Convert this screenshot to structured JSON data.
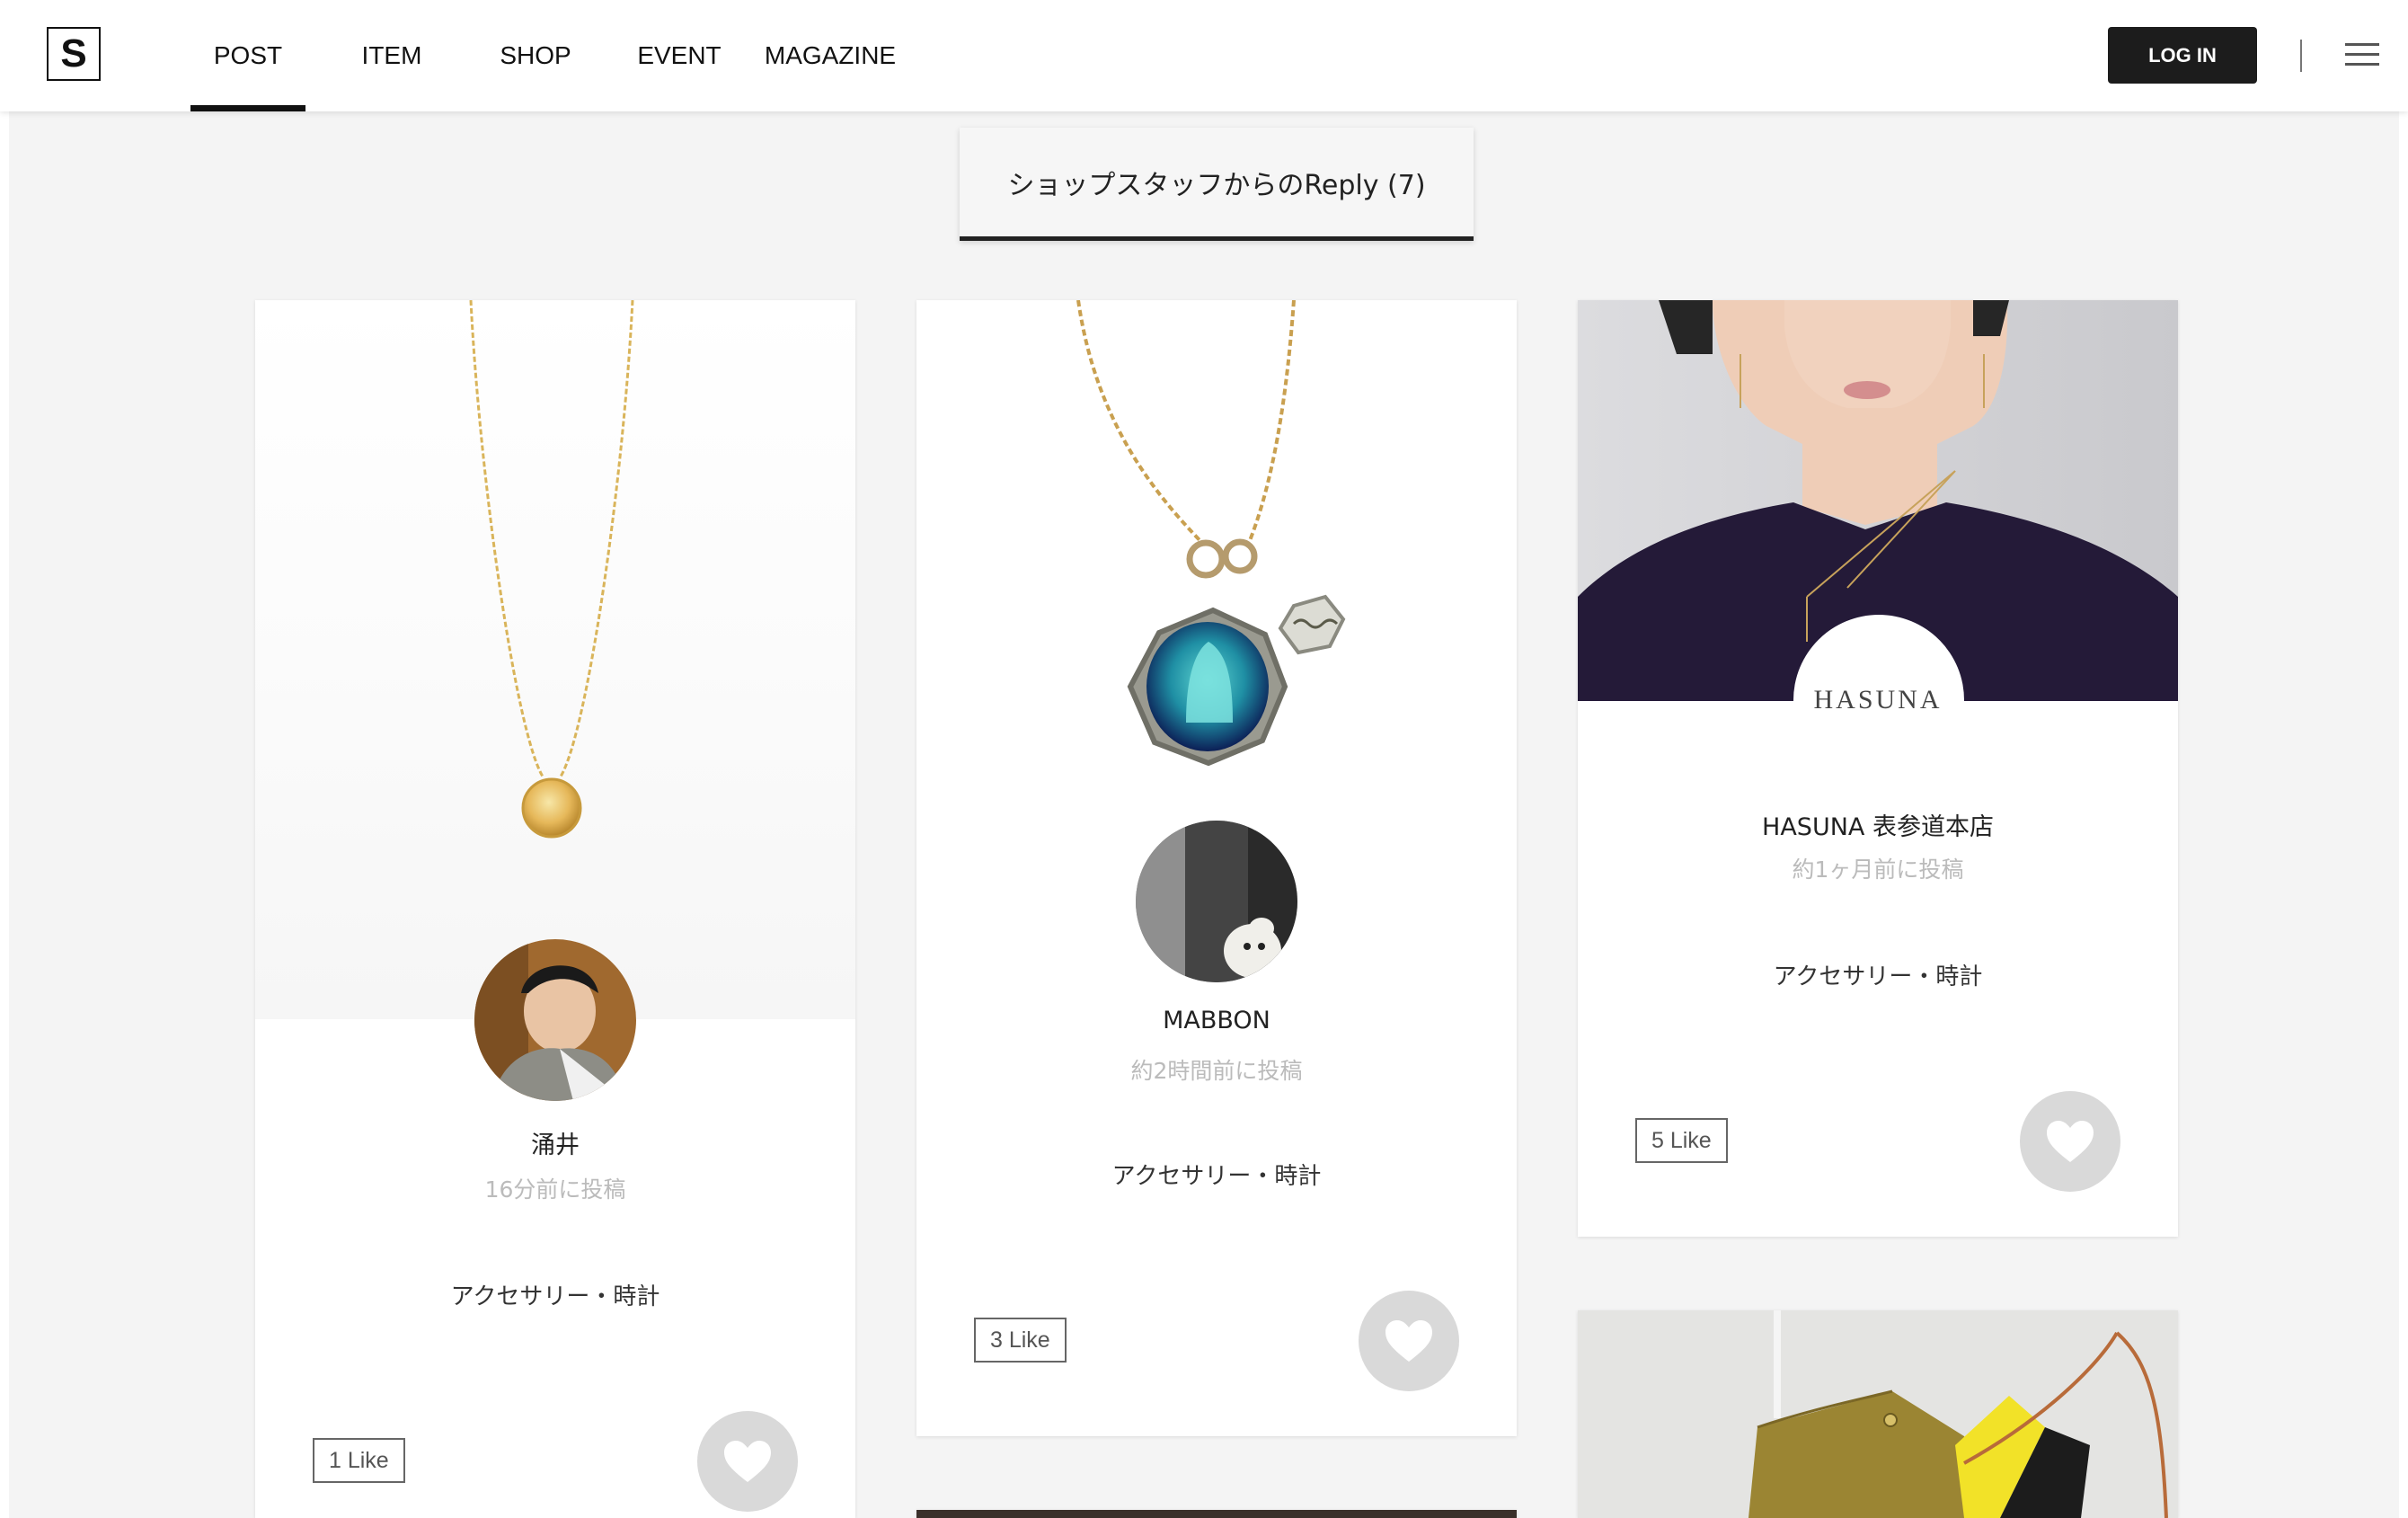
{
  "header": {
    "logo": "S",
    "nav": [
      {
        "label": "POST",
        "active": true
      },
      {
        "label": "ITEM",
        "active": false
      },
      {
        "label": "SHOP",
        "active": false
      },
      {
        "label": "EVENT",
        "active": false
      },
      {
        "label": "MAGAZINE",
        "active": false
      }
    ],
    "login_label": "LOG IN",
    "menu_icon": "hamburger-menu-icon"
  },
  "tab": {
    "label": "ショップスタッフからのReply (7)"
  },
  "cards": [
    {
      "name": "涌井",
      "time": "16分前に投稿",
      "category": "アクセサリー・時計",
      "likes": "1 Like",
      "image": "gold-citrine-necklace"
    },
    {
      "name": "MABBON",
      "time": "約2時間前に投稿",
      "category": "アクセサリー・時計",
      "likes": "3 Like",
      "image": "blue-medallion-necklace"
    },
    {
      "name": "HASUNA 表参道本店",
      "brand_logo": "HASUNA",
      "time": "約1ヶ月前に投稿",
      "category": "アクセサリー・時計",
      "likes": "5 Like",
      "image": "model-wearing-necklace"
    }
  ],
  "colors": {
    "accent": "#1c1c1c",
    "background": "#f4f4f4",
    "like_button": "#d9d9d9",
    "muted_text": "#bbbbbb"
  }
}
